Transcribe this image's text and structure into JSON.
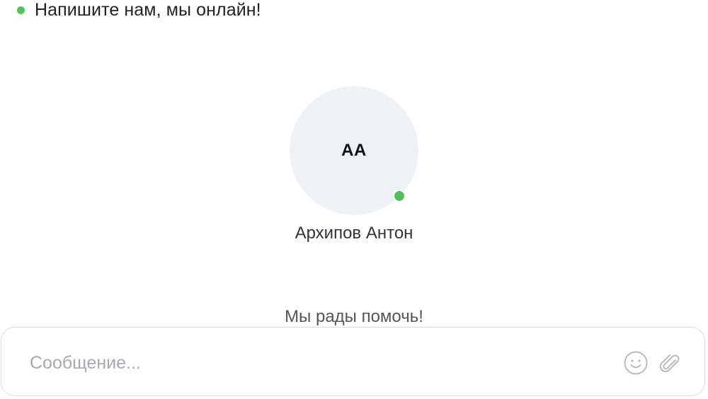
{
  "colors": {
    "online": "#4fc35a",
    "avatar_bg": "#eff2f5",
    "icon": "#b7bcc2"
  },
  "header": {
    "status_text": "Напишите нам, мы онлайн!"
  },
  "operator": {
    "initials": "АА",
    "name": "Архипов Антон",
    "online": true
  },
  "greeting": "Мы рады помочь!",
  "composer": {
    "placeholder": "Сообщение...",
    "value": "",
    "icons": [
      "smile-icon",
      "paperclip-icon"
    ]
  }
}
